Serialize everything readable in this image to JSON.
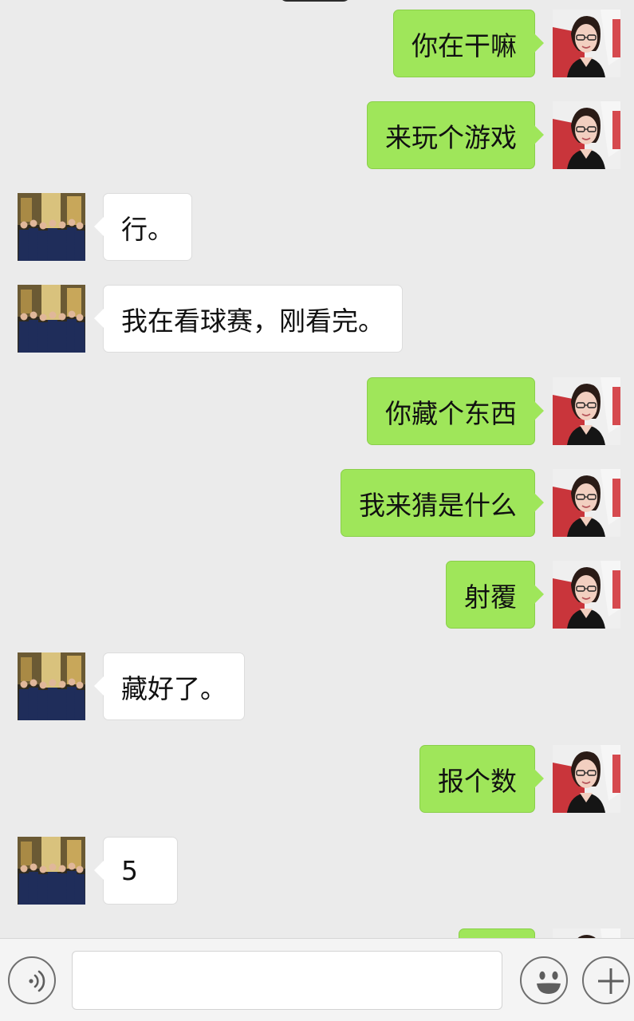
{
  "messages": [
    {
      "side": "right",
      "text": "你在干嘛"
    },
    {
      "side": "right",
      "text": "来玩个游戏"
    },
    {
      "side": "left",
      "text": "行。"
    },
    {
      "side": "left",
      "text": "我在看球赛，刚看完。"
    },
    {
      "side": "right",
      "text": "你藏个东西"
    },
    {
      "side": "right",
      "text": "我来猜是什么"
    },
    {
      "side": "right",
      "text": "射覆"
    },
    {
      "side": "left",
      "text": "藏好了。"
    },
    {
      "side": "right",
      "text": "报个数"
    },
    {
      "side": "left",
      "text": "5"
    },
    {
      "side": "right",
      "text": ""
    }
  ],
  "input": {
    "value": "",
    "placeholder": ""
  },
  "icons": {
    "voice": "voice-icon",
    "emoji": "emoji-icon",
    "plus": "plus-icon"
  },
  "colors": {
    "background": "#ebebeb",
    "sent_bubble": "#9fe65a",
    "received_bubble": "#ffffff",
    "input_bar": "#f4f4f4"
  }
}
